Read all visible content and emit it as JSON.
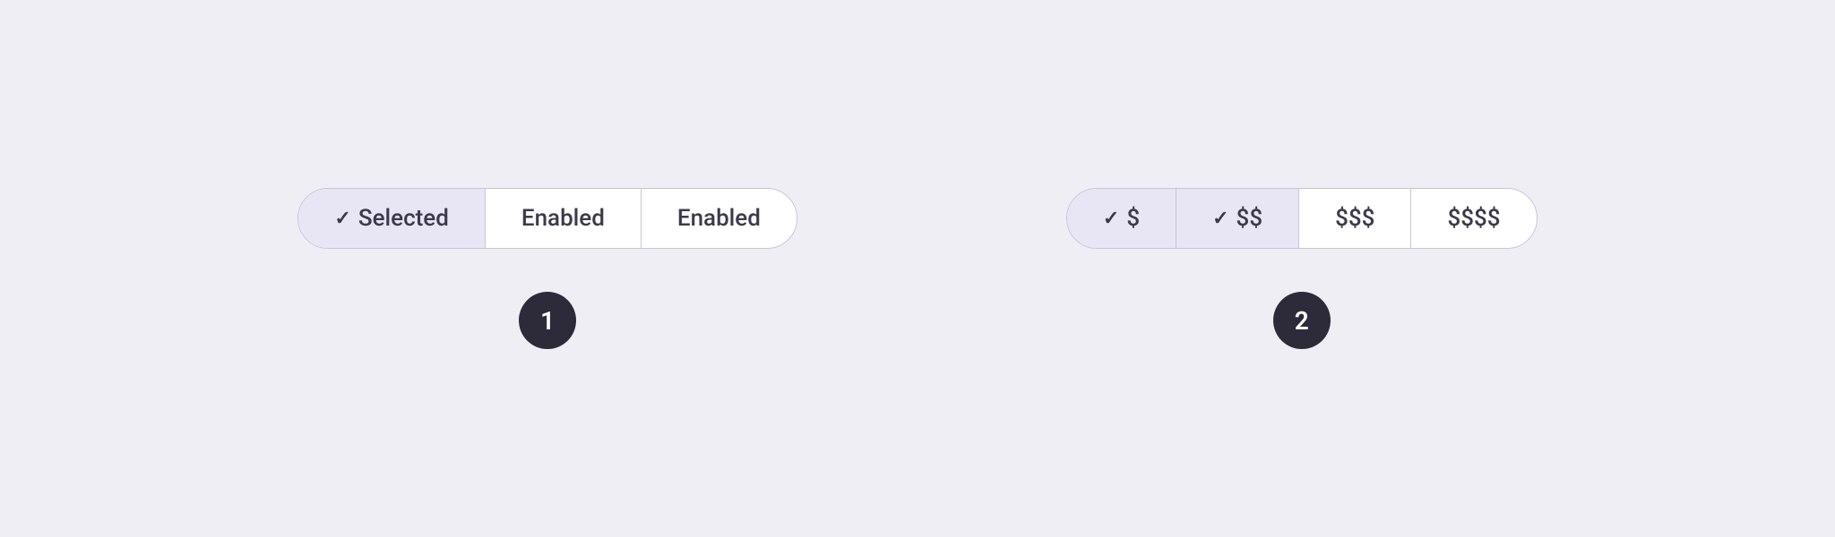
{
  "section1": {
    "badge": "1",
    "items": [
      {
        "id": "selected",
        "label": "Selected",
        "hasCheck": true,
        "state": "selected"
      },
      {
        "id": "enabled1",
        "label": "Enabled",
        "hasCheck": false,
        "state": "enabled"
      },
      {
        "id": "enabled2",
        "label": "Enabled",
        "hasCheck": false,
        "state": "enabled"
      }
    ]
  },
  "section2": {
    "badge": "2",
    "items": [
      {
        "id": "dollar1",
        "label": "$",
        "hasCheck": true,
        "state": "checked"
      },
      {
        "id": "dollar2",
        "label": "$$",
        "hasCheck": true,
        "state": "checked"
      },
      {
        "id": "dollar3",
        "label": "$$$",
        "hasCheck": false,
        "state": "enabled"
      },
      {
        "id": "dollar4",
        "label": "$$$$",
        "hasCheck": false,
        "state": "enabled"
      }
    ]
  },
  "icons": {
    "check": "✓"
  }
}
